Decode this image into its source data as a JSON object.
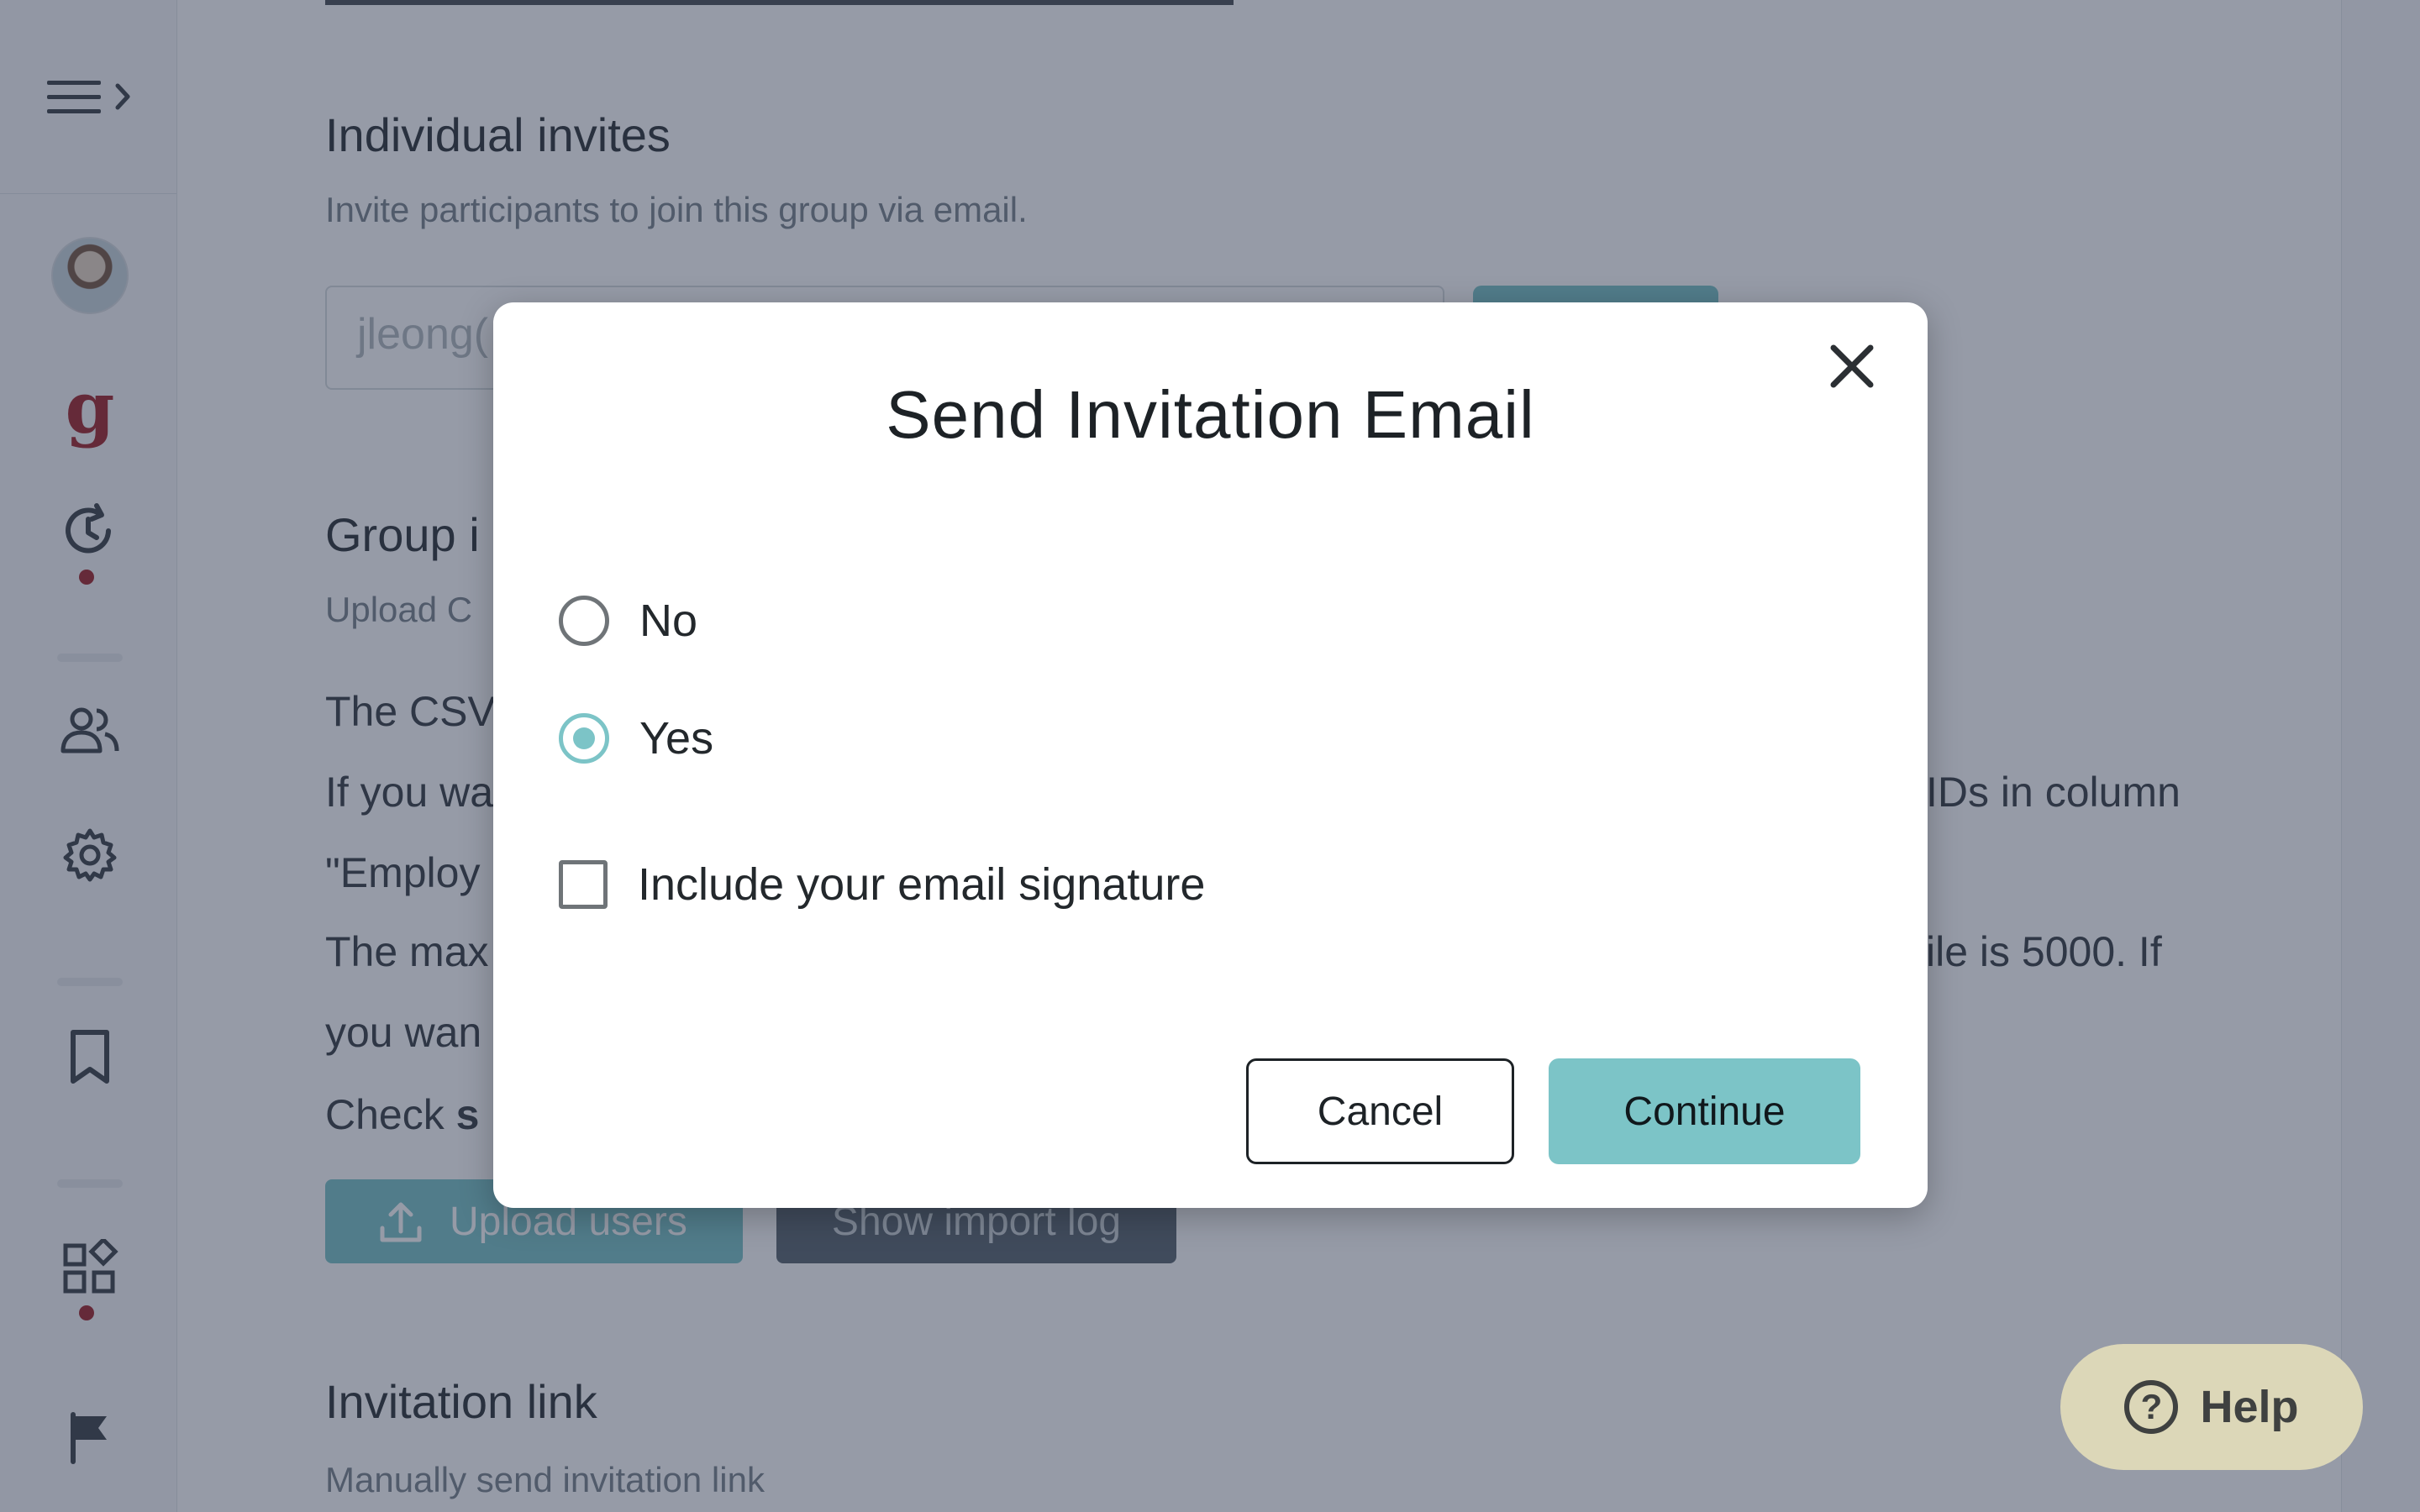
{
  "page": {
    "individual_invites": {
      "title": "Individual invites",
      "subtitle": "Invite participants to join this group via email.",
      "email_value": "jleong("
    },
    "group_import": {
      "title_partial": "Group i",
      "subtitle_partial": "Upload C",
      "line1_left": "The CSV",
      "line2_left": "If you wa",
      "line2_right": "IDs in column",
      "line3_left": "\"Employ",
      "line4_left": "The max",
      "line4_right": "ile is 5000. If",
      "line5_left": "you wan",
      "line6_left": "Check ",
      "line6_bold": "s",
      "upload_button": "Upload users",
      "import_log_button": "Show import log"
    },
    "invitation_link": {
      "title": "Invitation link",
      "subtitle": "Manually send invitation link"
    }
  },
  "modal": {
    "title": "Send Invitation Email",
    "options": [
      {
        "label": "No",
        "selected": false
      },
      {
        "label": "Yes",
        "selected": true
      }
    ],
    "signature_checkbox": {
      "label": "Include your email signature",
      "checked": false
    },
    "cancel_label": "Cancel",
    "continue_label": "Continue"
  },
  "help": {
    "label": "Help",
    "icon": "question-circle-icon"
  },
  "sidebar": {
    "icons": [
      "menu-icon",
      "chevron-right-icon",
      "avatar",
      "g-logo",
      "history-icon",
      "people-icon",
      "gear-icon",
      "bookmark-icon",
      "widgets-icon",
      "flag-icon"
    ],
    "logo_letter": "g"
  },
  "colors": {
    "accent": "#7cc4c7",
    "brand_red": "#a2282c",
    "overlay": "rgba(36, 46, 72, 0.48)",
    "help_bg": "#dcd7b8"
  }
}
